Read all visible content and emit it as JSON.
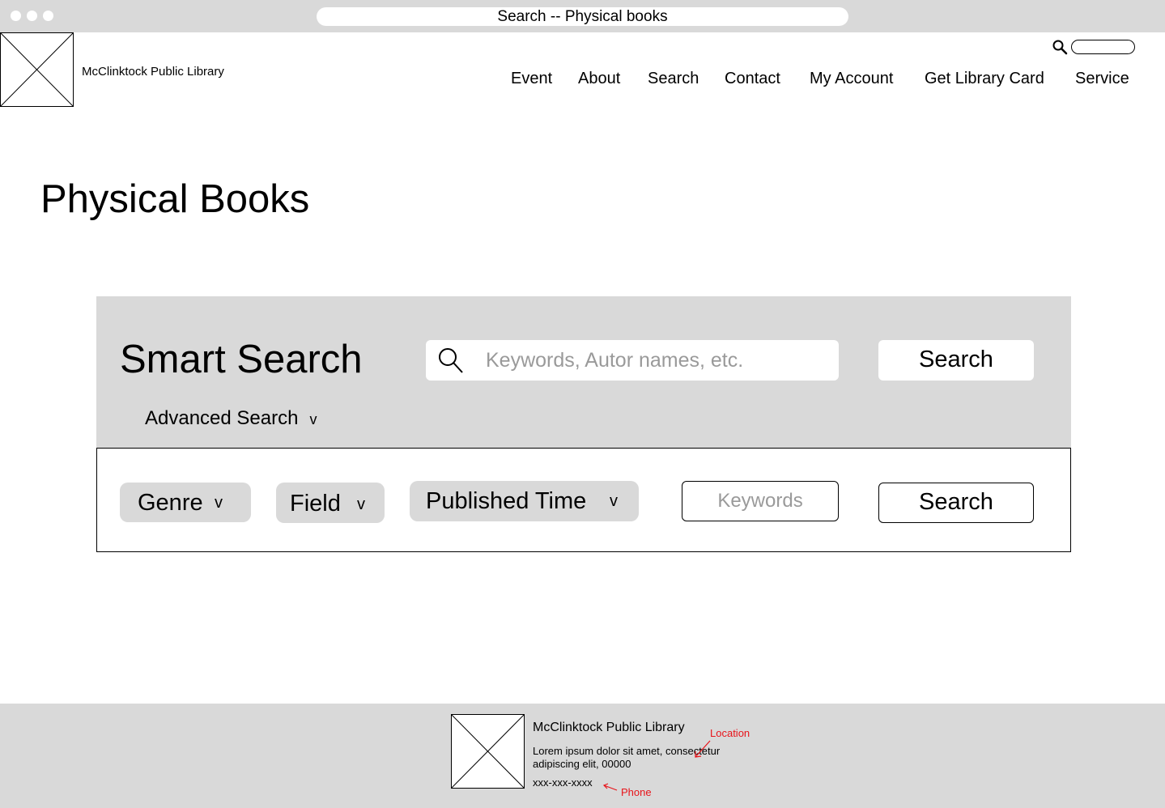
{
  "browser": {
    "title": "Search -- Physical books"
  },
  "header": {
    "library_name": "McClinktock Public Library",
    "nav": [
      "Event",
      "About",
      "Search",
      "Contact",
      "My Account",
      "Get Library Card",
      "Service"
    ]
  },
  "main": {
    "title": "Physical Books",
    "smart_search": {
      "title": "Smart Search",
      "placeholder": "Keywords, Autor names, etc.",
      "button": "Search",
      "advanced_toggle": "Advanced Search",
      "advanced_chevron": "v"
    },
    "advanced": {
      "genre": "Genre",
      "field": "Field",
      "published_time": "Published Time",
      "chevron": "v",
      "keywords_placeholder": "Keywords",
      "button": "Search"
    }
  },
  "footer": {
    "library_name": "McClinktock Public Library",
    "address": "Lorem ipsum dolor sit amet, consectetur adipiscing elit, 00000",
    "phone": "xxx-xxx-xxxx",
    "annotations": {
      "location": "Location",
      "phone": "Phone"
    }
  },
  "colors": {
    "panel_gray": "#d9d9d9",
    "annotation_red": "#e8141a",
    "placeholder_gray": "#9a9a9a"
  },
  "icons": [
    "search-icon",
    "image-placeholder-icon"
  ]
}
